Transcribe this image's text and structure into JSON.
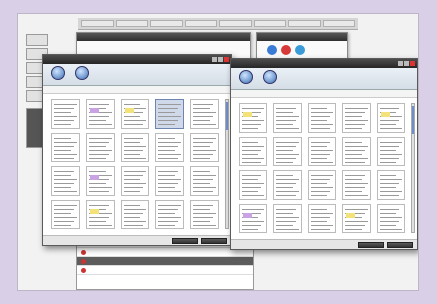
{
  "background": {
    "topbar_tabs": [
      "",
      "",
      "",
      "",
      "",
      "",
      "",
      "",
      "",
      ""
    ],
    "sidebar_items": [
      "",
      "",
      "",
      "",
      "",
      ""
    ],
    "windows": [
      {
        "title": ""
      },
      {
        "title": ""
      }
    ],
    "bottom_rows": [
      {
        "cols": [
          "",
          "",
          ""
        ]
      },
      {
        "cols": [
          "",
          "",
          ""
        ]
      },
      {
        "cols": [
          "",
          "",
          ""
        ]
      },
      {
        "cols": [
          "",
          "",
          ""
        ]
      }
    ]
  },
  "left_window": {
    "title": "",
    "tools": [
      {
        "label": "",
        "icon": "globe-icon"
      },
      {
        "label": "",
        "icon": "globe-icon"
      }
    ],
    "info_left": "",
    "info_right": "",
    "pages": 20
  },
  "right_window": {
    "title": "",
    "tools": [
      {
        "label": "",
        "icon": "globe-icon"
      },
      {
        "label": "",
        "icon": "globe-icon"
      }
    ],
    "info_left": "",
    "info_right": "",
    "pages": 20
  },
  "colors": {
    "backdrop": "#d9cfe6",
    "title_bar": "#2f2f2f",
    "selection": "#cfd9ea",
    "highlight": "#f9f3b5"
  }
}
